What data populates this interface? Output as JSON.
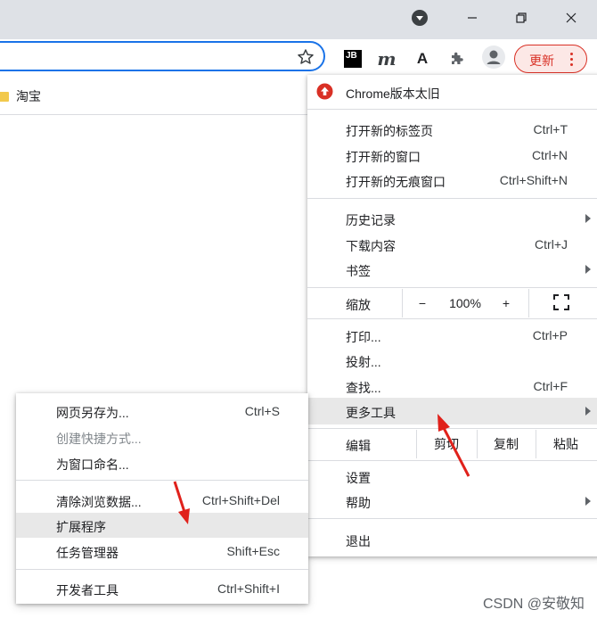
{
  "titlebar": {
    "icons": [
      "profile-dropdown-icon",
      "minimize-icon",
      "restore-icon",
      "close-icon"
    ]
  },
  "toolbar": {
    "extensions": [
      {
        "name": "jetbrains-extension-icon",
        "text": "JB"
      },
      {
        "name": "m-extension-icon",
        "text": "m"
      },
      {
        "name": "a-extension-icon",
        "text": "A"
      },
      {
        "name": "puzzle-icon",
        "text": ""
      },
      {
        "name": "profile-avatar-icon",
        "text": ""
      }
    ],
    "update_label": "更新",
    "accent": "#d93025"
  },
  "bookmarks": {
    "items": [
      {
        "label": "淘宝"
      }
    ]
  },
  "menu": {
    "update_item": "Chrome版本太旧",
    "new_tab": {
      "label": "打开新的标签页",
      "shortcut": "Ctrl+T"
    },
    "new_window": {
      "label": "打开新的窗口",
      "shortcut": "Ctrl+N"
    },
    "new_incognito": {
      "label": "打开新的无痕窗口",
      "shortcut": "Ctrl+Shift+N"
    },
    "history": {
      "label": "历史记录"
    },
    "downloads": {
      "label": "下载内容",
      "shortcut": "Ctrl+J"
    },
    "bookmarks": {
      "label": "书签"
    },
    "zoom": {
      "label": "缩放",
      "minus": "−",
      "value": "100%",
      "plus": "+"
    },
    "print": {
      "label": "打印...",
      "shortcut": "Ctrl+P"
    },
    "cast": {
      "label": "投射..."
    },
    "find": {
      "label": "查找...",
      "shortcut": "Ctrl+F"
    },
    "more_tools": {
      "label": "更多工具"
    },
    "edit": {
      "label": "编辑",
      "cut": "剪切",
      "copy": "复制",
      "paste": "粘贴"
    },
    "settings": {
      "label": "设置"
    },
    "help": {
      "label": "帮助"
    },
    "exit": {
      "label": "退出"
    }
  },
  "submenu": {
    "save_page": {
      "label": "网页另存为...",
      "shortcut": "Ctrl+S"
    },
    "create_shortcut": {
      "label": "创建快捷方式..."
    },
    "name_window": {
      "label": "为窗口命名..."
    },
    "clear_data": {
      "label": "清除浏览数据...",
      "shortcut": "Ctrl+Shift+Del"
    },
    "extensions": {
      "label": "扩展程序"
    },
    "task_manager": {
      "label": "任务管理器",
      "shortcut": "Shift+Esc"
    },
    "dev_tools": {
      "label": "开发者工具",
      "shortcut": "Ctrl+Shift+I"
    }
  },
  "watermark": "CSDN @安敬知"
}
